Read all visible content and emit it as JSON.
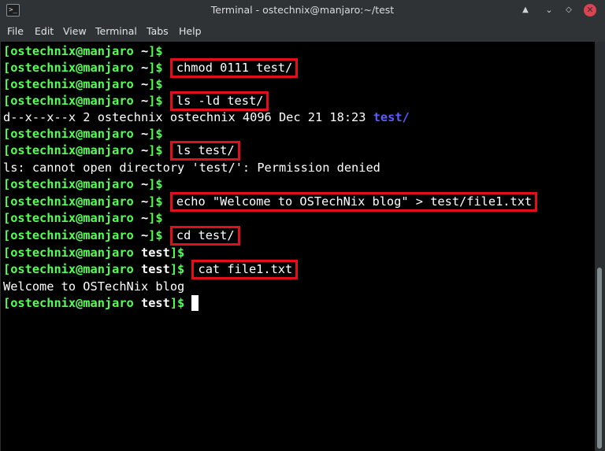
{
  "window": {
    "title": "Terminal - ostechnix@manjaro:~/test",
    "icon": "terminal-icon",
    "buttons": [
      "keep-above-icon",
      "minimize-icon",
      "maximize-icon",
      "close-icon"
    ]
  },
  "menu": [
    "File",
    "Edit",
    "View",
    "Terminal",
    "Tabs",
    "Help"
  ],
  "colors": {
    "prompt": "#54ff54",
    "highlight_box": "#e0101a",
    "directory_listing": "#5c5cff",
    "background": "#000000"
  },
  "terminal": {
    "prompt_user": "[ostechnix@manjaro",
    "home_dir": "~",
    "test_dir": "test",
    "prompt_end": "]$",
    "cmd_chmod": "chmod 0111 test/",
    "cmd_ls_ld": "ls -ld test/",
    "ls_ld_output": "d--x--x--x 2 ostechnix ostechnix 4096 Dec 21 18:23 ",
    "ls_ld_name": "test/",
    "cmd_ls": "ls test/",
    "ls_error": "ls: cannot open directory 'test/': Permission denied",
    "cmd_echo": "echo \"Welcome to OSTechNix blog\" > test/file1.txt",
    "cmd_cd": "cd test/",
    "cmd_cat": "cat file1.txt",
    "cat_output": "Welcome to OSTechNix blog"
  }
}
